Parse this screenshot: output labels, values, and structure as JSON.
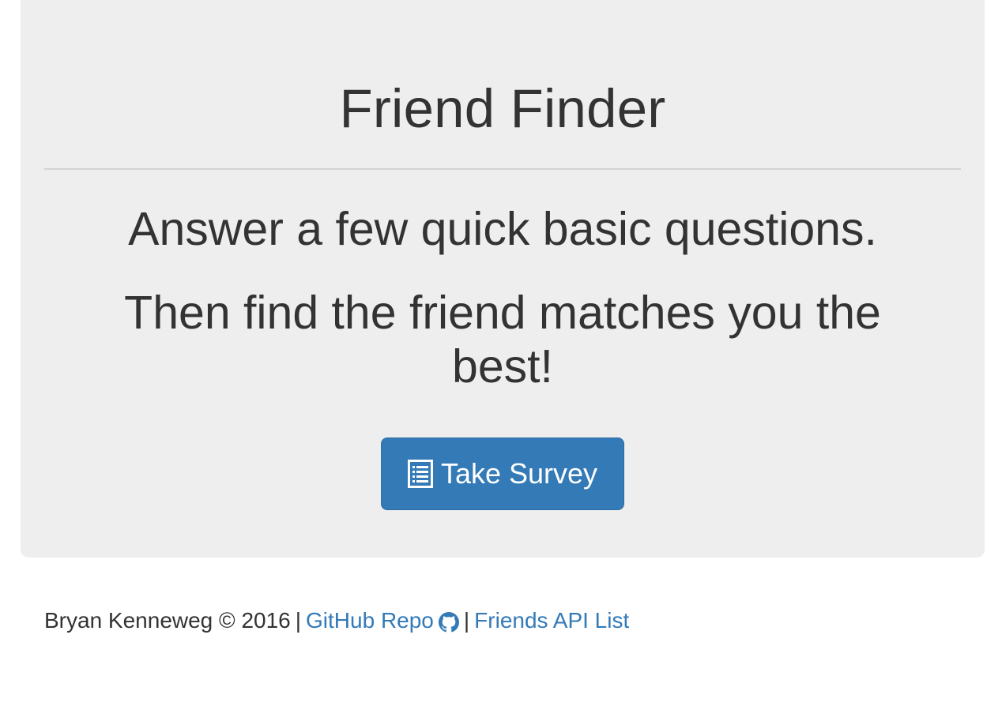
{
  "hero": {
    "title": "Friend Finder",
    "tagline_1": "Answer a few quick basic questions.",
    "tagline_2": "Then find the friend matches you the best!",
    "button_label": "Take Survey",
    "button_icon": "list-alt-icon",
    "background_color": "#eeeeee",
    "button_color": "#337ab7"
  },
  "footer": {
    "credit": "Bryan Kenneweg © 2016",
    "separator": "|",
    "repo_link": "GitHub Repo",
    "repo_icon": "github-icon",
    "api_link": "Friends API List",
    "link_color": "#337ab7"
  }
}
